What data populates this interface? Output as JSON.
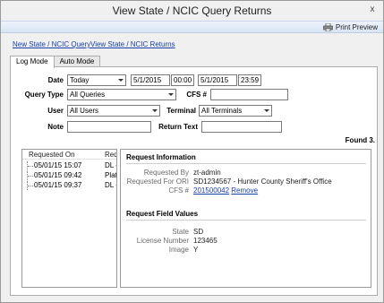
{
  "window": {
    "title": "View State / NCIC Query Returns",
    "close_glyph": "x"
  },
  "toolbar": {
    "print_label": "Print Preview"
  },
  "links": {
    "new_query": "New State / NCIC Query",
    "view_returns": "View State / NCIC Returns"
  },
  "tabs": [
    {
      "label": "Log Mode",
      "active": true
    },
    {
      "label": "Auto Mode",
      "active": false
    }
  ],
  "form": {
    "date_label": "Date",
    "date_range": "Today",
    "start_date": "5/1/2015",
    "start_time": "00:00",
    "end_date": "5/1/2015",
    "end_time": "23:59",
    "query_type_label": "Query Type",
    "query_type": "All Queries",
    "cfs_label": "CFS #",
    "cfs_value": "",
    "user_label": "User",
    "user": "All Users",
    "terminal_label": "Terminal",
    "terminal": "All Terminals",
    "note_label": "Note",
    "note_value": "",
    "return_text_label": "Return Text",
    "return_text_value": ""
  },
  "found_text": "Found 3.",
  "list": {
    "columns": [
      "Requested On",
      "Req"
    ],
    "rows": [
      {
        "requested_on": "05/01/15 15:07",
        "req": "DL -"
      },
      {
        "requested_on": "05/01/15 09:42",
        "req": "Plate"
      },
      {
        "requested_on": "05/01/15 09:37",
        "req": "DL -"
      }
    ]
  },
  "detail": {
    "request_info_title": "Request Information",
    "requested_by_label": "Requested By",
    "requested_by": "zt-admin",
    "requested_for_ori_label": "Requested For ORI",
    "requested_for_ori": "SD1234567 - Hunter County Sheriff's Office",
    "cfs_label": "CFS #",
    "cfs_value": "201500042",
    "remove_label": "Remove",
    "field_values_title": "Request Field Values",
    "state_label": "State",
    "state_value": "SD",
    "license_label": "License Number",
    "license_value": "123465",
    "image_label": "Image",
    "image_value": "Y"
  }
}
